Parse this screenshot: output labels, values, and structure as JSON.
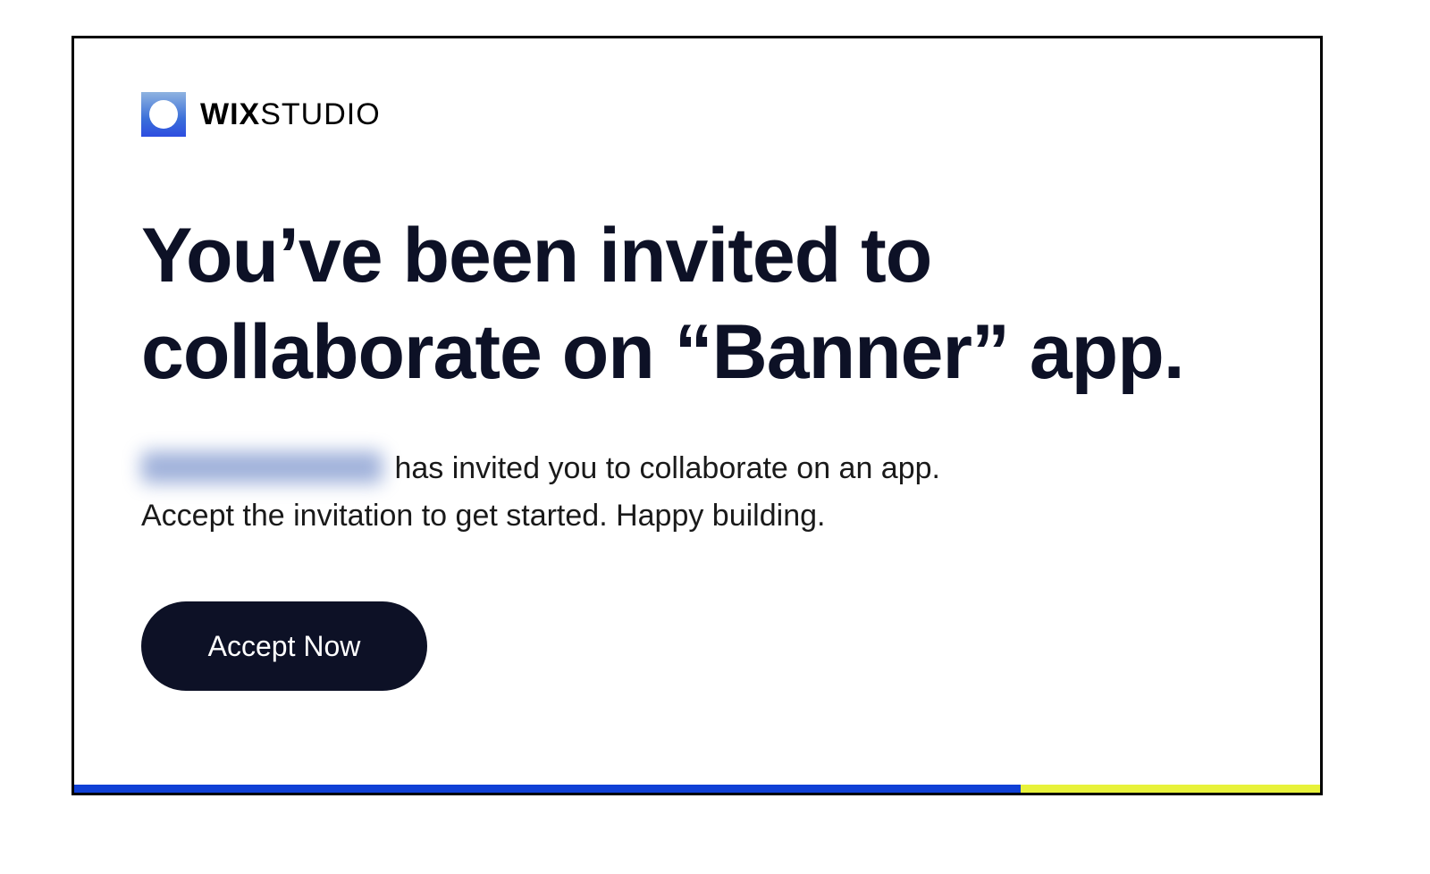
{
  "logo": {
    "brand_bold": "WIX",
    "brand_light": "STUDIO"
  },
  "headline": "You’ve been invited to collaborate on “Banner” app.",
  "body": {
    "line1_after": " has invited you to collaborate on an app.",
    "line2": "Accept the invitation to get started. Happy building."
  },
  "cta_label": "Accept Now"
}
